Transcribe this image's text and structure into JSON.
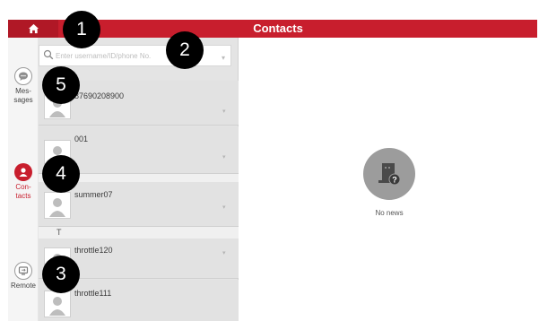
{
  "header": {
    "title": "Contacts",
    "home_icon": "home-icon",
    "color": "#c81e2d"
  },
  "rail": {
    "items": [
      {
        "label": "Mes-\nsages",
        "icon": "chat-bubble-icon",
        "active": false
      },
      {
        "label": "Con-\ntacts",
        "icon": "person-icon",
        "active": true
      },
      {
        "label": "Remote",
        "icon": "remote-screen-icon",
        "active": false
      }
    ]
  },
  "search": {
    "placeholder": "Enter username/ID/phone No."
  },
  "contacts": {
    "rows": [
      {
        "name": "87690208900"
      },
      {
        "name": "001"
      },
      {
        "name": "summer07"
      },
      {
        "name": "throttle120"
      },
      {
        "name": "throttle111"
      }
    ],
    "section_letter": "T"
  },
  "main": {
    "empty_text": "No news",
    "empty_icon": "no-news-icon"
  },
  "markers": [
    "1",
    "2",
    "3",
    "4",
    "5"
  ]
}
